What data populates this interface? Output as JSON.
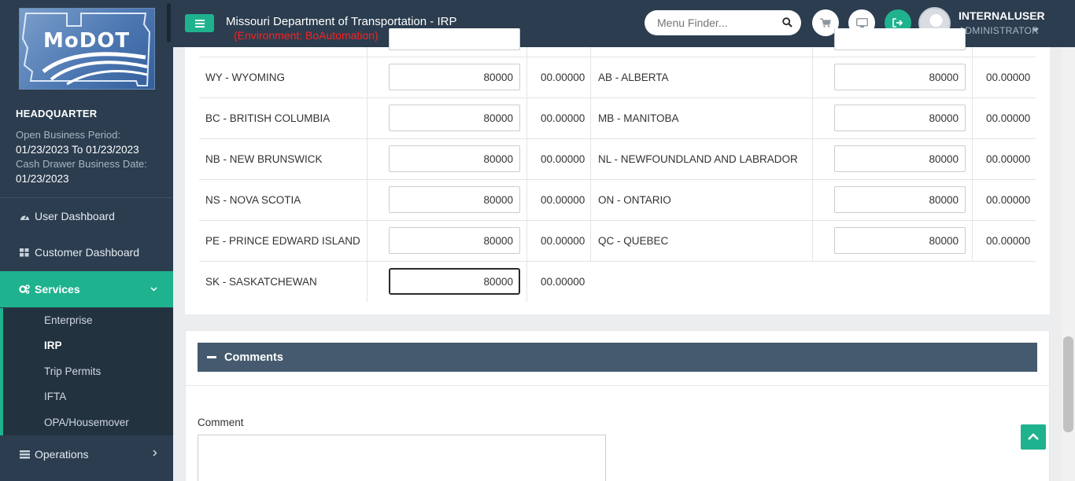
{
  "app": {
    "title": "Missouri Department of Transportation - IRP",
    "environment": "(Environment: BoAutomation)",
    "logo_text": "MoDOT"
  },
  "sidebar": {
    "office": "HEADQUARTER",
    "open_period_label": "Open Business Period:",
    "open_period_value": "01/23/2023 To 01/23/2023",
    "cash_drawer_label": "Cash Drawer Business Date:",
    "cash_drawer_value": "01/23/2023",
    "nav": [
      {
        "label": "User Dashboard",
        "icon": "dashboard-icon"
      },
      {
        "label": "Customer Dashboard",
        "icon": "grid-icon"
      },
      {
        "label": "Services",
        "icon": "cogs-icon",
        "active": true
      },
      {
        "label": "Operations",
        "icon": "list-icon"
      }
    ],
    "sub_items": [
      "Enterprise",
      "IRP",
      "Trip Permits",
      "IFTA",
      "OPA/Housemover"
    ],
    "active_sub": "IRP"
  },
  "header": {
    "search_placeholder": "Menu Finder...",
    "user_name": "INTERNALUSER",
    "user_role": "ADMINISTRATOR",
    "icons": [
      "cart-icon",
      "monitor-icon",
      "logout-icon"
    ]
  },
  "jurisdictions": {
    "rows": [
      {
        "left": {
          "name": "WY - WYOMING",
          "value": "80000",
          "pct": "00.00000"
        },
        "right": {
          "name": "AB - ALBERTA",
          "value": "80000",
          "pct": "00.00000"
        }
      },
      {
        "left": {
          "name": "BC - BRITISH COLUMBIA",
          "value": "80000",
          "pct": "00.00000"
        },
        "right": {
          "name": "MB - MANITOBA",
          "value": "80000",
          "pct": "00.00000"
        }
      },
      {
        "left": {
          "name": "NB - NEW BRUNSWICK",
          "value": "80000",
          "pct": "00.00000"
        },
        "right": {
          "name": "NL - NEWFOUNDLAND AND LABRADOR",
          "value": "80000",
          "pct": "00.00000"
        }
      },
      {
        "left": {
          "name": "NS - NOVA SCOTIA",
          "value": "80000",
          "pct": "00.00000"
        },
        "right": {
          "name": "ON - ONTARIO",
          "value": "80000",
          "pct": "00.00000"
        }
      },
      {
        "left": {
          "name": "PE - PRINCE EDWARD ISLAND",
          "value": "80000",
          "pct": "00.00000"
        },
        "right": {
          "name": "QC - QUEBEC",
          "value": "80000",
          "pct": "00.00000"
        }
      },
      {
        "left": {
          "name": "SK - SASKATCHEWAN",
          "value": "80000",
          "pct": "00.00000"
        }
      }
    ]
  },
  "comments": {
    "title": "Comments",
    "label": "Comment",
    "value": ""
  },
  "colors": {
    "sidebar": "#2b3d4f",
    "accent": "#1fb28e",
    "env_text": "#ff2020",
    "section_header": "#455a6e"
  }
}
